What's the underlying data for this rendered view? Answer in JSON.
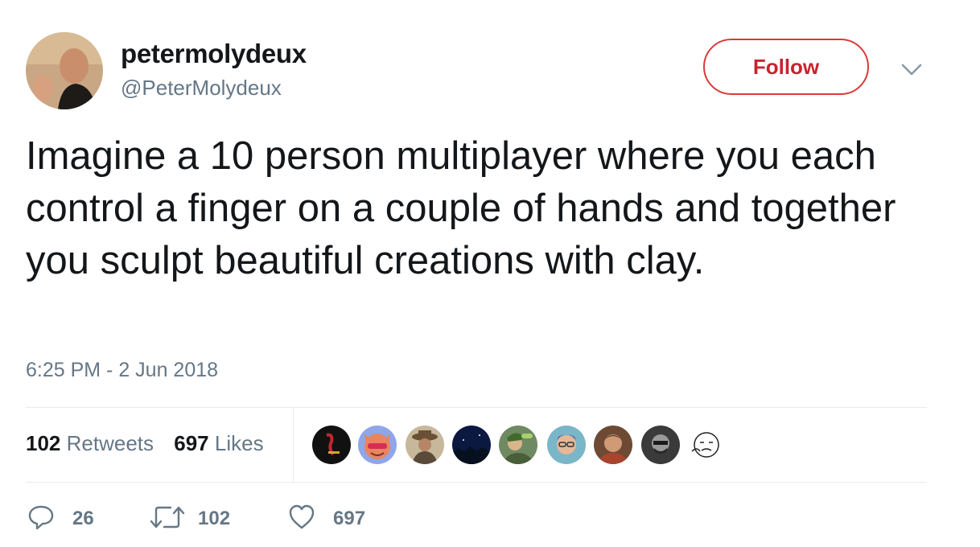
{
  "author": {
    "name": "petermolydeux",
    "handle": "@PeterMolydeux"
  },
  "follow_label": "Follow",
  "tweet_text": "Imagine a 10 person multiplayer where you each control a finger on a couple of hands and together you sculpt beautiful creations with clay.",
  "timestamp": "6:25 PM - 2 Jun 2018",
  "stats": {
    "retweets_count": "102",
    "retweets_label": "Retweets",
    "likes_count": "697",
    "likes_label": "Likes"
  },
  "actions": {
    "reply_count": "26",
    "retweet_count": "102",
    "like_count": "697"
  },
  "colors": {
    "follow_accent": "#c8232f",
    "muted_text": "#657786",
    "divider": "#e6ecf0"
  },
  "icons": [
    "chevron-down-icon",
    "reply-icon",
    "retweet-icon",
    "heart-icon"
  ]
}
